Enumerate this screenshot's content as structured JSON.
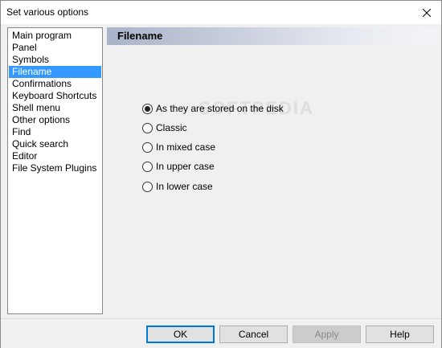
{
  "window": {
    "title": "Set various options"
  },
  "sidebar": {
    "items": [
      {
        "label": "Main program"
      },
      {
        "label": "Panel"
      },
      {
        "label": "Symbols"
      },
      {
        "label": "Filename"
      },
      {
        "label": "Confirmations"
      },
      {
        "label": "Keyboard Shortcuts"
      },
      {
        "label": "Shell menu"
      },
      {
        "label": "Other options"
      },
      {
        "label": "Find"
      },
      {
        "label": "Quick search"
      },
      {
        "label": "Editor"
      },
      {
        "label": "File System Plugins"
      }
    ],
    "selected_index": 3
  },
  "panel": {
    "title": "Filename"
  },
  "options": [
    {
      "label": "As they are stored on the disk",
      "checked": true
    },
    {
      "label": "Classic",
      "checked": false
    },
    {
      "label": "In mixed case",
      "checked": false
    },
    {
      "label": "In upper case",
      "checked": false
    },
    {
      "label": "In lower case",
      "checked": false
    }
  ],
  "buttons": {
    "ok": "OK",
    "cancel": "Cancel",
    "apply": "Apply",
    "help": "Help"
  },
  "watermark": "SOFTPEDIA",
  "colors": {
    "selection": "#3399ff",
    "default_button_border": "#0078d7"
  }
}
